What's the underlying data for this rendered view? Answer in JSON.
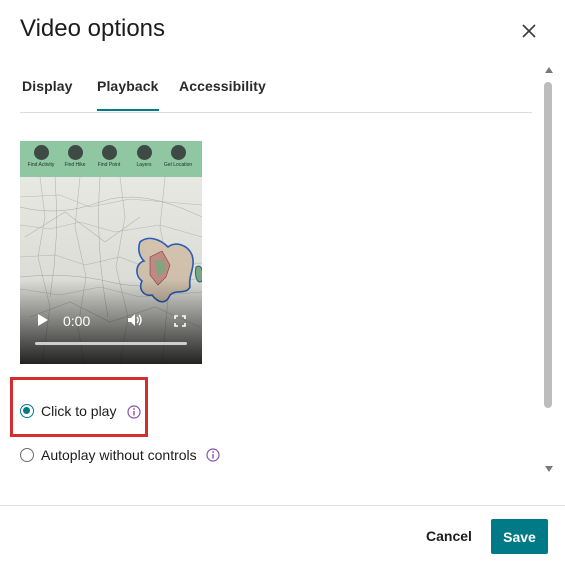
{
  "dialog": {
    "title": "Video options"
  },
  "tabs": [
    {
      "label": "Display",
      "selected": false
    },
    {
      "label": "Playback",
      "selected": true
    },
    {
      "label": "Accessibility",
      "selected": false
    }
  ],
  "video": {
    "toolbar": [
      "Find Activity",
      "Find Hike",
      "Find Point",
      "Layers",
      "Get Location"
    ],
    "current_time": "0:00",
    "progress": 0
  },
  "playback_options": [
    {
      "label": "Click to play",
      "checked": true
    },
    {
      "label": "Autoplay without controls",
      "checked": false
    }
  ],
  "footer": {
    "cancel_label": "Cancel",
    "save_label": "Save"
  },
  "colors": {
    "accent": "#007a87",
    "highlight": "#d32d2d",
    "info_icon": "#8a4fb0"
  },
  "icons": [
    "close-icon",
    "play-icon",
    "volume-icon",
    "fullscreen-icon",
    "info-icon"
  ]
}
